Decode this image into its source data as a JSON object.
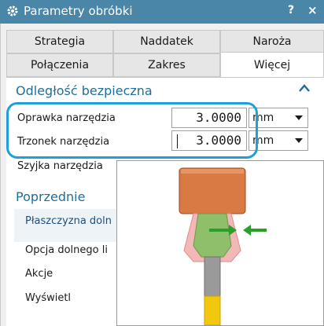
{
  "window": {
    "title": "Parametry obróbki",
    "help_label": "?",
    "close_label": "×"
  },
  "tabs": {
    "row1": [
      "Strategia",
      "Naddatek",
      "Naroża"
    ],
    "row2": [
      "Połączenia",
      "Zakres",
      "Więcej"
    ],
    "active": "Więcej"
  },
  "safety": {
    "title": "Odległość bezpieczna",
    "holder_label": "Oprawka narzędzia",
    "holder_value": "3.0000",
    "holder_unit": "mm",
    "shank_label": "Trzonek narzędzia",
    "shank_value": "3.0000",
    "shank_unit": "mm",
    "neck_label": "Szyjka narzędzia"
  },
  "previous": {
    "title": "Poprzednie",
    "plane_label": "Płaszczyzna doln",
    "bottom_option_label": "Opcja dolnego li",
    "actions_label": "Akcje",
    "display_label": "Wyświetl"
  },
  "colors": {
    "titlebar": "#4a86a8",
    "accent": "#1f6e9a",
    "highlight": "#1fa0d8",
    "holder_orange": "#d97a45",
    "shank_green": "#8fbf6a",
    "arrow_green": "#2aa02a",
    "neck_pink": "#f2b8b8",
    "tool_yellow": "#f2c80f",
    "tool_gray": "#9a9a9a"
  }
}
